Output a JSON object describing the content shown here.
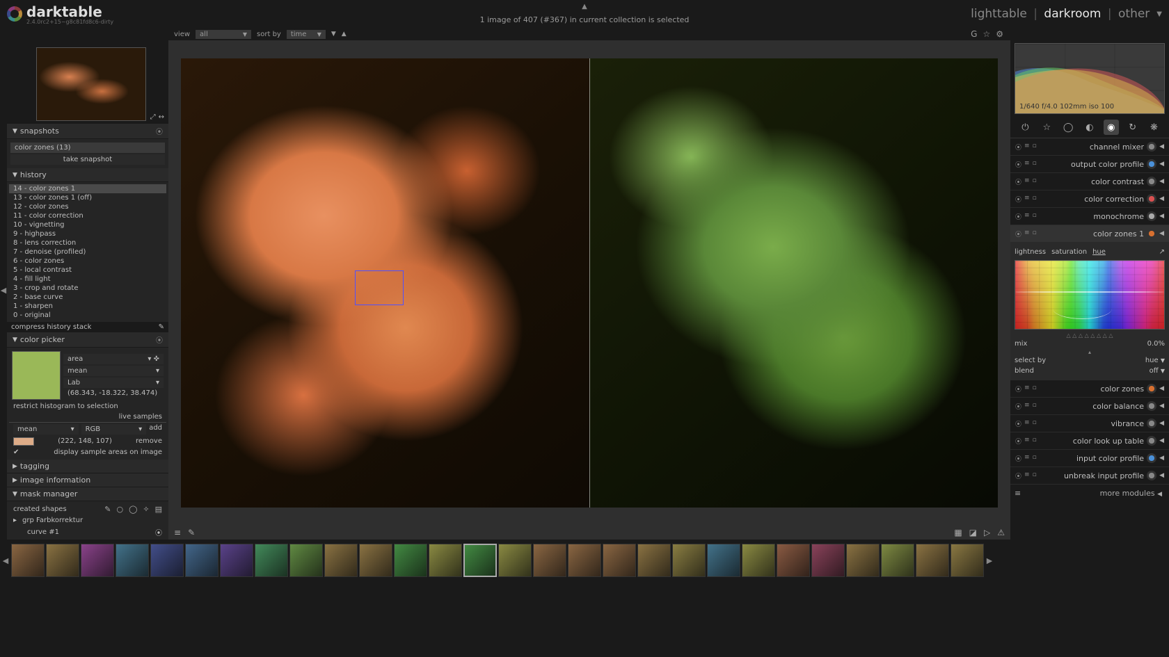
{
  "app": {
    "name": "darktable",
    "version": "2.4.0rc2+15~g8c81fd8c6-dirty"
  },
  "top": {
    "status": "1 image of 407 (#367) in current collection is selected",
    "views": {
      "lighttable": "lighttable",
      "darkroom": "darkroom",
      "other": "other"
    }
  },
  "toolbar": {
    "view_label": "view",
    "view_value": "all",
    "sort_label": "sort by",
    "sort_value": "time"
  },
  "snapshots": {
    "title": "snapshots",
    "item": "color zones (13)",
    "take": "take snapshot"
  },
  "history": {
    "title": "history",
    "items": [
      "14 - color zones 1",
      "13 - color zones 1 (off)",
      "12 - color zones",
      "11 - color correction",
      "10 - vignetting",
      "9 - highpass",
      "8 - lens correction",
      "7 - denoise (profiled)",
      "6 - color zones",
      "5 - local contrast",
      "4 - fill light",
      "3 - crop and rotate",
      "2 - base curve",
      "1 - sharpen",
      "0 - original"
    ],
    "compress": "compress history stack"
  },
  "colorpicker": {
    "title": "color picker",
    "mode": "area",
    "stat": "mean",
    "space": "Lab",
    "lab": "(68.343, -18.322, 38.474)",
    "restrict": "restrict histogram to selection",
    "live": "live samples",
    "col1": "mean",
    "col2": "RGB",
    "add": "add",
    "rgb": "(222, 148, 107)",
    "remove": "remove",
    "display": "display sample areas on image",
    "swatch_hex": "#9ab858",
    "chip_hex": "#deac88"
  },
  "tagging": {
    "title": "tagging"
  },
  "imageinfo": {
    "title": "image information"
  },
  "maskmgr": {
    "title": "mask manager",
    "created": "created shapes",
    "grp": "grp Farbkorrektur",
    "curve": "curve #1"
  },
  "histogram": {
    "info": "1/640 f/4.0 102mm iso 100"
  },
  "module_groups": [
    "power",
    "star",
    "base",
    "tone",
    "color",
    "correct",
    "effect"
  ],
  "modules": [
    {
      "name": "channel mixer",
      "icon": "swirl",
      "hex": "#888"
    },
    {
      "name": "output color profile",
      "icon": "disc",
      "hex": "#4a90d8"
    },
    {
      "name": "color contrast",
      "icon": "circle",
      "hex": "#888"
    },
    {
      "name": "color correction",
      "icon": "rgb",
      "hex": "#d85050"
    },
    {
      "name": "monochrome",
      "icon": "half",
      "hex": "#aaa"
    },
    {
      "name": "color zones 1",
      "icon": "wheel",
      "hex": "#d87030",
      "active": true
    },
    {
      "name": "color zones",
      "icon": "wheel",
      "hex": "#d87030"
    },
    {
      "name": "color balance",
      "icon": "circle",
      "hex": "#888"
    },
    {
      "name": "vibrance",
      "icon": "circle",
      "hex": "#888"
    },
    {
      "name": "color look up table",
      "icon": "circle",
      "hex": "#888"
    },
    {
      "name": "input color profile",
      "icon": "disc",
      "hex": "#4a90d8"
    },
    {
      "name": "unbreak input profile",
      "icon": "circle",
      "hex": "#888"
    }
  ],
  "colorzones": {
    "tabs": {
      "l": "lightness",
      "s": "saturation",
      "h": "hue"
    },
    "mix_label": "mix",
    "mix_value": "0.0%",
    "select_label": "select by",
    "select_value": "hue",
    "blend_label": "blend",
    "blend_value": "off"
  },
  "more_modules": "more modules",
  "filmstrip_count": 28
}
